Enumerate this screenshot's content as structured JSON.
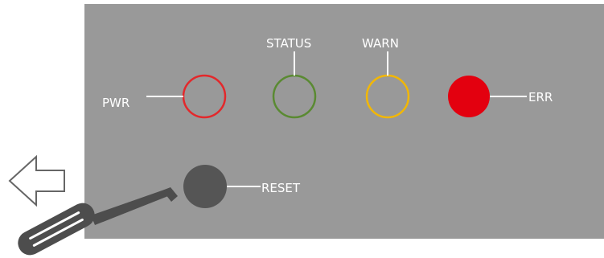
{
  "panel": {
    "labels": {
      "pwr": "PWR",
      "status": "STATUS",
      "warn": "WARN",
      "err": "ERR",
      "reset": "RESET"
    }
  },
  "colors": {
    "panel": "#999999",
    "pwr_ring": "#e3282b",
    "status_ring": "#5a8a32",
    "warn_ring": "#f2b705",
    "err_led": "#e3000f",
    "reset_button": "#555555",
    "tool": "#4d4d4d"
  },
  "indicators": {
    "pwr": "off",
    "status": "off",
    "warn": "off",
    "err": "on"
  },
  "icons": {
    "arrow": "arrow-left-icon",
    "tool": "screwdriver-icon"
  }
}
